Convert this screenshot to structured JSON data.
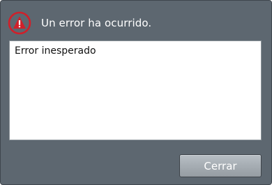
{
  "dialog": {
    "title": "Un error ha ocurrido.",
    "message": "Error inesperado",
    "close_label": "Cerrar",
    "icon": "warning-icon"
  },
  "colors": {
    "background": "#5d6770",
    "accent_red": "#d0202a",
    "text_white": "#ffffff"
  }
}
